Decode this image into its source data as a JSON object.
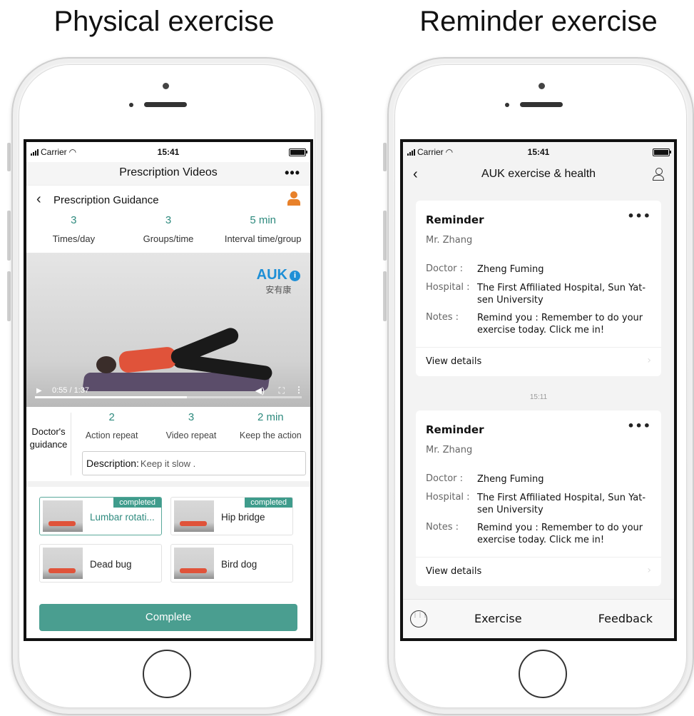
{
  "left": {
    "heading": "Physical exercise",
    "status": {
      "carrier": "Carrier",
      "time": "15:41"
    },
    "nav_title": "Prescription Videos",
    "more": "•••",
    "guidance_title": "Prescription Guidance",
    "stats": [
      {
        "value": "3",
        "label": "Times/day"
      },
      {
        "value": "3",
        "label": "Groups/time"
      },
      {
        "value": "5 min",
        "label": "Interval time/group"
      }
    ],
    "video": {
      "logo": "AUK",
      "logo_info": "i",
      "logo_cn": "安有康",
      "time": "0:55 / 1:37",
      "progress": 0.57
    },
    "doctor": {
      "label_line1": "Doctor's",
      "label_line2": "guidance",
      "stats": [
        {
          "value": "2",
          "label": "Action repeat"
        },
        {
          "value": "3",
          "label": "Video repeat"
        },
        {
          "value": "2 min",
          "label": "Keep the action"
        }
      ],
      "desc_label": "Description:",
      "desc_value": "Keep it slow ."
    },
    "cards": [
      {
        "name": "Lumbar rotati...",
        "badge": "completed"
      },
      {
        "name": "Hip bridge",
        "badge": "completed"
      },
      {
        "name": "Dead bug"
      },
      {
        "name": "Bird dog"
      }
    ],
    "complete": "Complete"
  },
  "right": {
    "heading": "Reminder exercise",
    "status": {
      "carrier": "Carrier",
      "time": "15:41"
    },
    "nav_title": "AUK exercise & health",
    "reminders": [
      {
        "title": "Reminder",
        "user": "Mr. Zhang",
        "doctor_k": "Doctor :",
        "doctor_v": "Zheng Fuming",
        "hospital_k": "Hospital :",
        "hospital_v": "The First Affiliated Hospital, Sun Yat-sen University",
        "notes_k": "Notes :",
        "notes_v": "Remind you : Remember to do your exercise today. Click me in!",
        "view": "View details"
      },
      {
        "title": "Reminder",
        "user": "Mr. Zhang",
        "doctor_k": "Doctor :",
        "doctor_v": "Zheng Fuming",
        "hospital_k": "Hospital :",
        "hospital_v": "The First Affiliated Hospital, Sun Yat-sen University",
        "notes_k": "Notes :",
        "notes_v": "Remind you : Remember to do your exercise today. Click me in!",
        "view": "View details"
      }
    ],
    "time_sep": "15:11",
    "tabs": {
      "exercise": "Exercise",
      "feedback": "Feedback"
    }
  },
  "colors": {
    "accent": "#4a9e90",
    "accent_text": "#2e8a7e",
    "logo": "#1e8fd6",
    "doctor_icon": "#e8812a"
  },
  "icons": [
    "back-chevron-icon",
    "doctor-icon",
    "play-icon",
    "volume-icon",
    "fullscreen-icon",
    "person-icon",
    "keyboard-icon",
    "wifi-icon",
    "signal-icon",
    "battery-icon"
  ]
}
